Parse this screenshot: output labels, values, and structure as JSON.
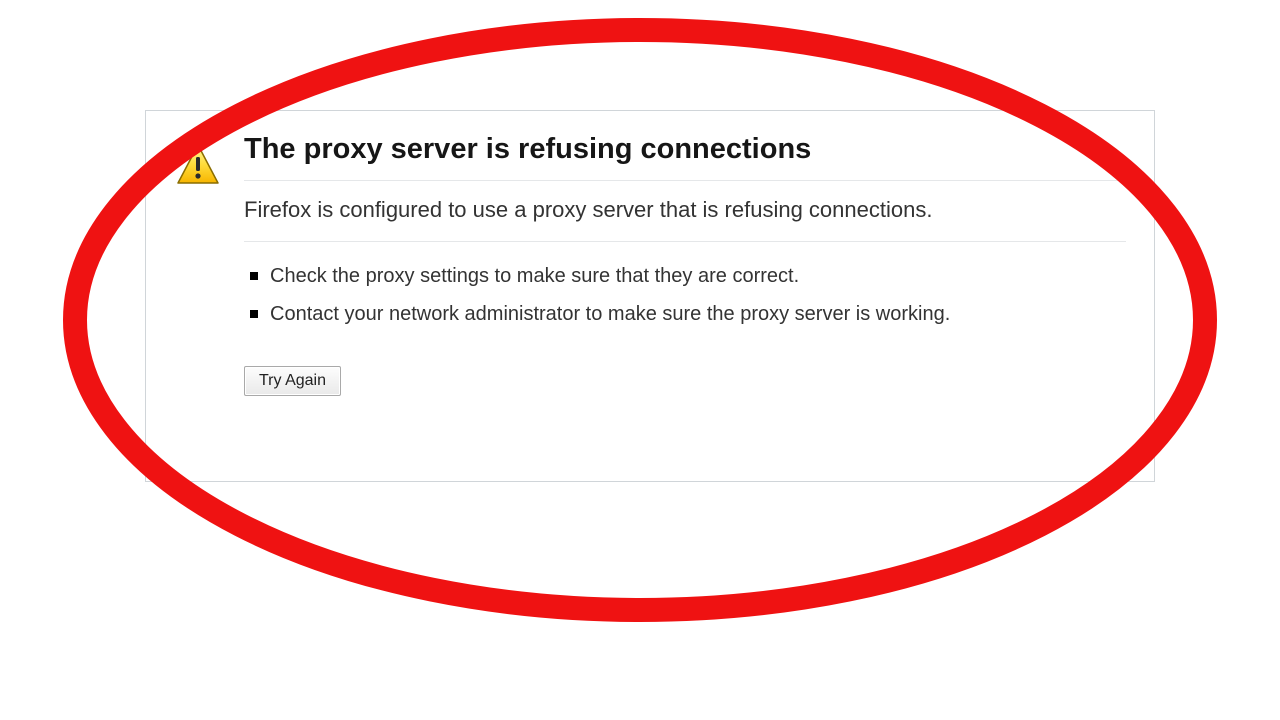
{
  "error": {
    "title": "The proxy server is refusing connections",
    "description": "Firefox is configured to use a proxy server that is refusing connections.",
    "suggestions": [
      "Check the proxy settings to make sure that they are correct.",
      "Contact your network administrator to make sure the proxy server is working."
    ],
    "retry_label": "Try Again"
  }
}
